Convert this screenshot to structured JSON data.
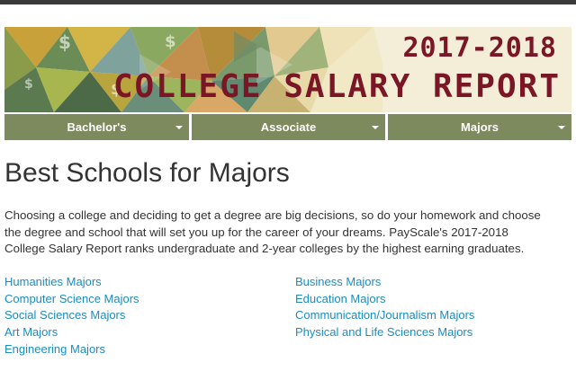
{
  "banner": {
    "year": "2017-2018",
    "title": "COLLEGE SALARY REPORT"
  },
  "nav": {
    "items": [
      {
        "label": "Bachelor's"
      },
      {
        "label": "Associate"
      },
      {
        "label": "Majors"
      }
    ]
  },
  "main": {
    "title": "Best Schools for Majors",
    "intro": "Choosing a college and deciding to get a degree are big decisions, so do your homework and choose the degree and school that will set you up for the career of your dreams. PayScale's 2017-2018 College Salary Report ranks undergraduate and 2-year colleges by the highest earning graduates."
  },
  "links": {
    "left": [
      {
        "label": "Humanities Majors"
      },
      {
        "label": "Computer Science Majors"
      },
      {
        "label": "Social Sciences Majors"
      },
      {
        "label": "Art Majors"
      },
      {
        "label": "Engineering Majors"
      }
    ],
    "right": [
      {
        "label": "Business Majors"
      },
      {
        "label": "Education Majors"
      },
      {
        "label": "Communication/Journalism Majors"
      },
      {
        "label": "Physical and Life Sciences Majors"
      }
    ]
  },
  "colors": {
    "nav_bg": "#7c8a5e",
    "link": "#1a8cc2",
    "banner_text": "#7a1626",
    "banner_bg": "#f4eed8"
  }
}
